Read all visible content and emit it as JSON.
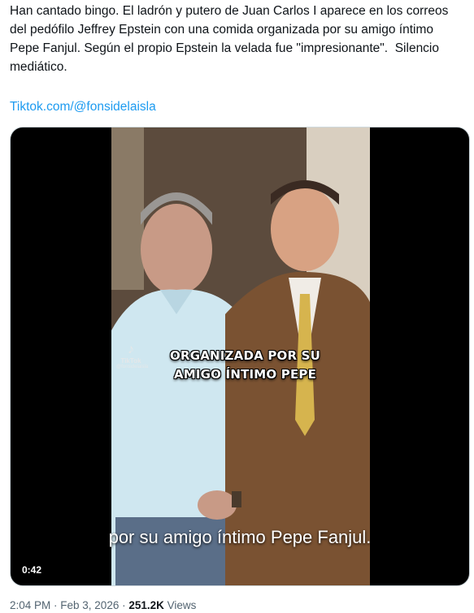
{
  "tweet": {
    "text": "Han cantado bingo. El ladrón y putero de Juan Carlos I aparece en los correos del pedófilo Jeffrey Epstein con una comida organizada por su amigo íntimo Pepe Fanjul. Según el propio Epstein la velada fue \"impresionante\".  Silencio mediático.",
    "link": "Tiktok.com/@fonsidelaisla"
  },
  "video": {
    "overlay_caption_line1": "ORGANIZADA POR SU",
    "overlay_caption_line2": "AMIGO ÍNTIMO PEPE",
    "subtitle": "por su amigo íntimo Pepe Fanjul.",
    "duration": "0:42",
    "tiktok_label": "TikTok",
    "tiktok_handle": "@fonsidelaisla"
  },
  "meta": {
    "time": "2:04 PM",
    "sep1": " · ",
    "date": "Feb 3, 2026",
    "sep2": " · ",
    "views_count": "251.2K",
    "views_label": " Views"
  }
}
